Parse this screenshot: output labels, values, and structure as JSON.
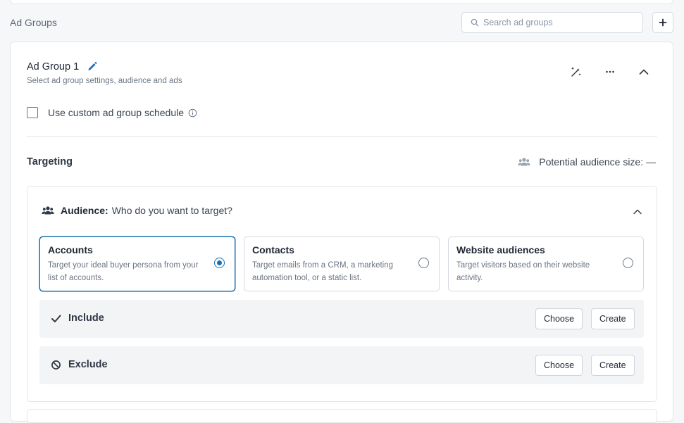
{
  "section": {
    "title": "Ad Groups",
    "search_placeholder": "Search ad groups",
    "add_icon": "plus-icon"
  },
  "ad_group": {
    "title": "Ad Group 1",
    "subtitle": "Select ad group settings, audience and ads",
    "edit_icon": "pencil-icon",
    "header_icons": [
      "magic-wand-icon",
      "more-horizontal-icon",
      "chevron-up-icon"
    ],
    "custom_schedule_label": "Use custom ad group schedule",
    "custom_schedule_checked": false
  },
  "targeting": {
    "title": "Targeting",
    "audience_size_label": "Potential audience size: —",
    "audience": {
      "label_bold": "Audience:",
      "label_text": "Who do you want to target?",
      "options": [
        {
          "title": "Accounts",
          "description": "Target your ideal buyer persona from your list of accounts.",
          "selected": true
        },
        {
          "title": "Contacts",
          "description": "Target emails from a CRM, a marketing automation tool, or a static list.",
          "selected": false
        },
        {
          "title": "Website audiences",
          "description": "Target visitors based on their website activity.",
          "selected": false
        }
      ],
      "include": {
        "label": "Include",
        "choose": "Choose",
        "create": "Create"
      },
      "exclude": {
        "label": "Exclude",
        "choose": "Choose",
        "create": "Create"
      }
    }
  },
  "colors": {
    "accent": "#1a6fae",
    "pencil": "#1f73c4",
    "border": "#e3e6ea",
    "muted_text": "#6b7684"
  }
}
